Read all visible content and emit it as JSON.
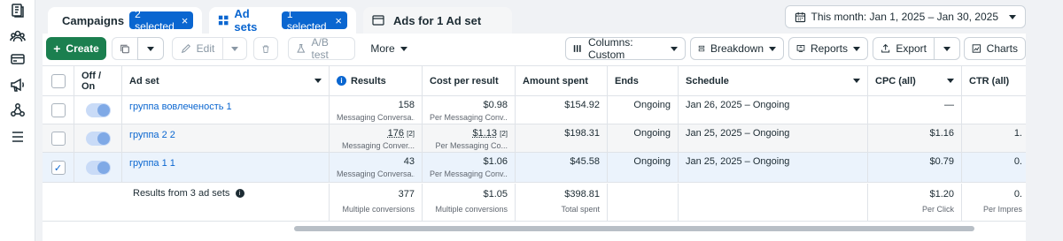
{
  "tabs": [
    {
      "label": "Campaigns",
      "chip": "2 selected",
      "state": "inactive-white"
    },
    {
      "label": "Ad sets",
      "chip": "1 selected",
      "state": "active"
    },
    {
      "label": "Ads for 1 Ad set",
      "state": "inactive"
    }
  ],
  "date_range": "This month: Jan 1, 2025 – Jan 30, 2025",
  "toolbar": {
    "create": "Create",
    "edit": "Edit",
    "ab_test": "A/B test",
    "more": "More",
    "columns": "Columns: Custom",
    "breakdown": "Breakdown",
    "reports": "Reports",
    "export": "Export",
    "charts": "Charts"
  },
  "columns": {
    "off_on": "Off / On",
    "ad_set": "Ad set",
    "results": "Results",
    "cost_per_result": "Cost per result",
    "amount_spent": "Amount spent",
    "ends": "Ends",
    "schedule": "Schedule",
    "cpc": "CPC (all)",
    "ctr": "CTR (all)"
  },
  "rows": [
    {
      "name": "группа вовлеченость 1",
      "results": "158",
      "results_sub": "Messaging Conversa...",
      "cpr": "$0.98",
      "cpr_sub": "Per Messaging Conv...",
      "spent": "$154.92",
      "ends": "Ongoing",
      "schedule": "Jan 26, 2025 – Ongoing",
      "cpc": "—",
      "ctr": "",
      "checked": false
    },
    {
      "name": "группа 2 2",
      "results": "176",
      "results_note": "[2]",
      "results_sub": "Messaging Conver...",
      "cpr": "$1.13",
      "cpr_note": "[2]",
      "cpr_sub": "Per Messaging Co...",
      "spent": "$198.31",
      "ends": "Ongoing",
      "schedule": "Jan 25, 2025 – Ongoing",
      "cpc": "$1.16",
      "ctr": "1.",
      "checked": false
    },
    {
      "name": "группа 1 1",
      "results": "43",
      "results_sub": "Messaging Conversa...",
      "cpr": "$1.06",
      "cpr_sub": "Per Messaging Conv...",
      "spent": "$45.58",
      "ends": "Ongoing",
      "schedule": "Jan 25, 2025 – Ongoing",
      "cpc": "$0.79",
      "ctr": "0.",
      "checked": true
    }
  ],
  "totals": {
    "label": "Results from 3 ad sets",
    "results": "377",
    "results_sub": "Multiple conversions",
    "cpr": "$1.05",
    "cpr_sub": "Multiple conversions",
    "spent": "$398.81",
    "spent_sub": "Total spent",
    "cpc": "$1.20",
    "cpc_sub": "Per Click",
    "ctr": "0.",
    "ctr_sub": "Per Impres"
  },
  "icons": [
    "pages-icon",
    "audience-icon",
    "billing-icon",
    "megaphone-icon",
    "business-graph-icon",
    "menu-icon"
  ],
  "colors": {
    "accent": "#0a66d0",
    "create_green": "#1b7f4f"
  }
}
